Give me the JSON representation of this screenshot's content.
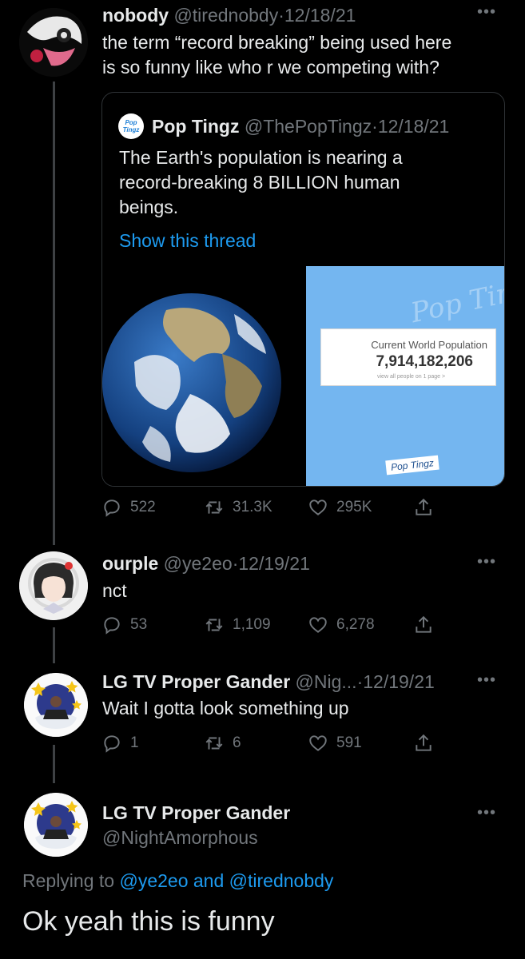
{
  "tweet1": {
    "name": "nobody",
    "handle": "@tirednobdy",
    "date": "12/18/21",
    "text_line1": "the term “record breaking” being used here",
    "text_line2": "is so funny like who r we competing with?",
    "quote": {
      "name": "Pop Tingz",
      "handle": "@ThePopTingz",
      "date": "12/18/21",
      "avatar_text": "Pop Tingz",
      "text_line1": "The Earth's population is nearing a",
      "text_line2": "record-breaking 8 BILLION human",
      "text_line3": "beings.",
      "show_thread": "Show this thread",
      "card_title": "Current World Population",
      "card_value": "7,914,182,206",
      "card_sub": "view all people on 1 page >",
      "watermark": "Pop Tingz"
    },
    "replies": "522",
    "retweets": "31.3K",
    "likes": "295K"
  },
  "tweet2": {
    "name": "ourple",
    "handle": "@ye2eo",
    "date": "12/19/21",
    "text": "nct",
    "replies": "53",
    "retweets": "1,109",
    "likes": "6,278"
  },
  "tweet3": {
    "name": "LG TV Proper Gander",
    "handle": "@Nig...",
    "date": "12/19/21",
    "text": "Wait I gotta look something up",
    "replies": "1",
    "retweets": "6",
    "likes": "591"
  },
  "tweet4": {
    "name": "LG TV Proper Gander",
    "handle": "@NightAmorphous",
    "replying_prefix": "Replying to",
    "replying_user1": "@ye2eo",
    "replying_and": "and",
    "replying_user2": "@tirednobdy",
    "text": "Ok yeah this is funny"
  },
  "separator": "·",
  "colors": {
    "accent": "#1d9bf0",
    "muted": "#71767b",
    "background": "#000000"
  }
}
